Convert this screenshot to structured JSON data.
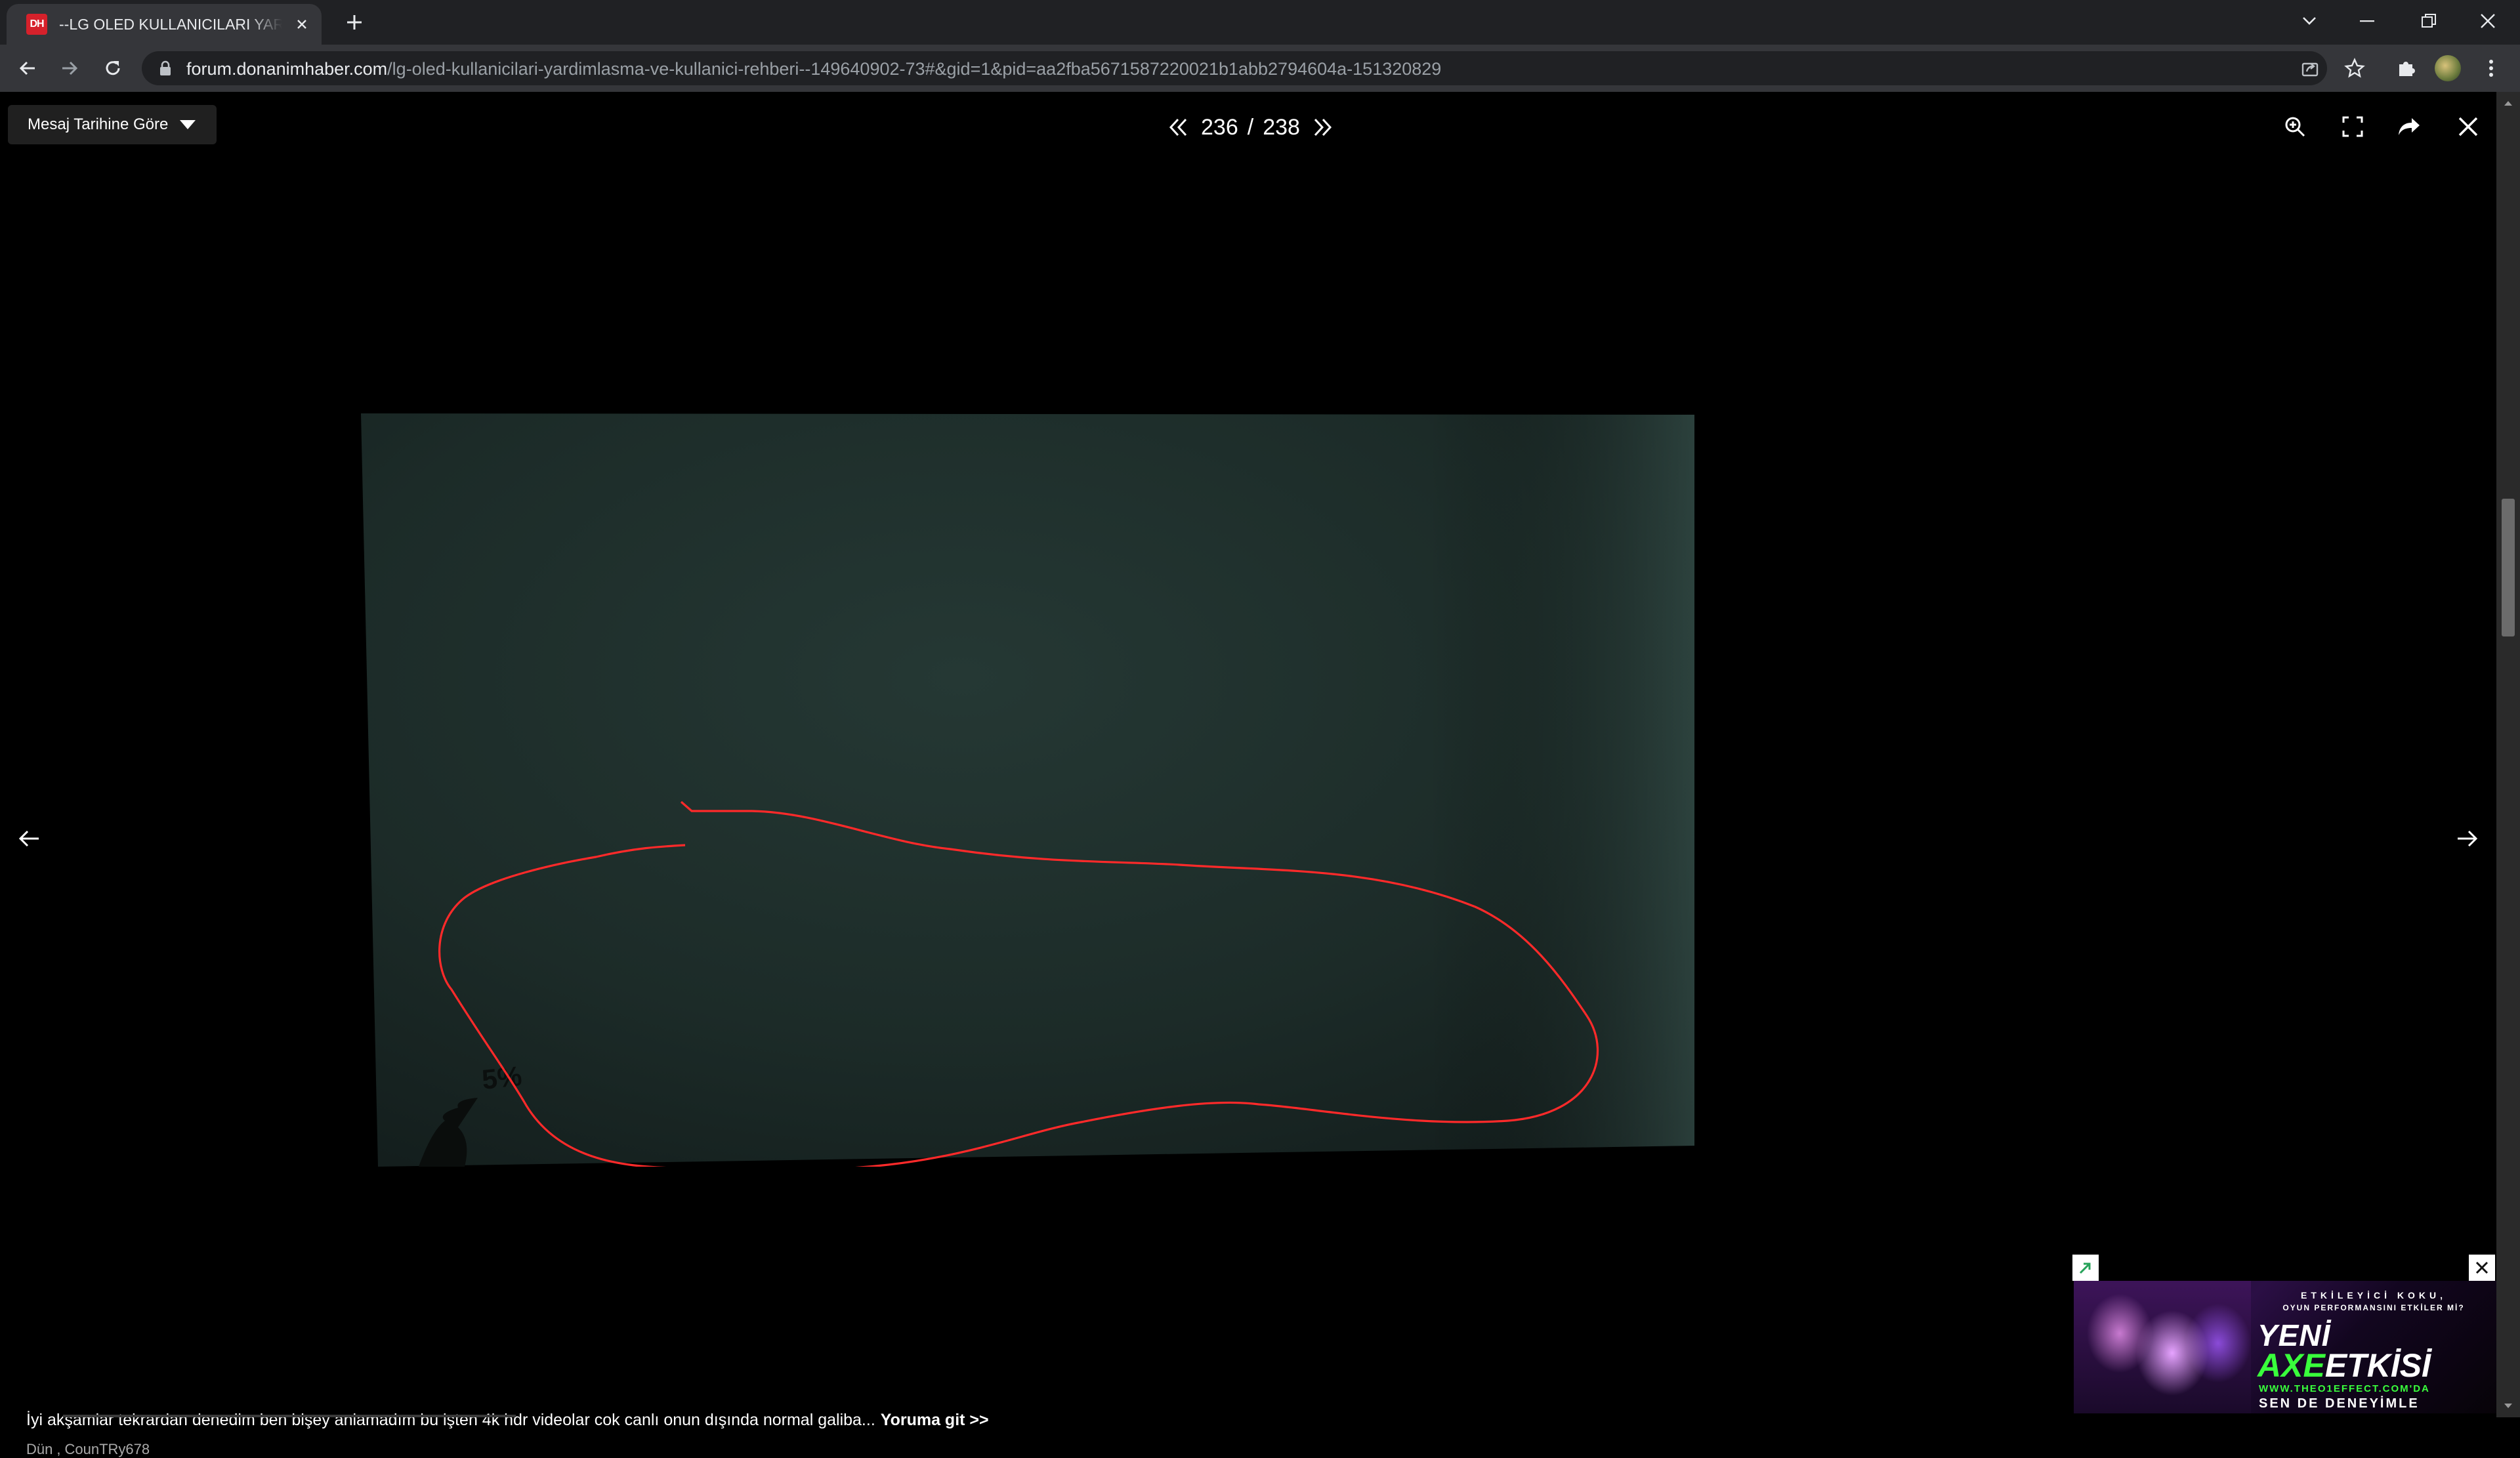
{
  "browser": {
    "tab": {
      "favicon_text": "DH",
      "title": "--LG OLED KULLANICILARI YARDIMLAŞMA VE KULLANICI REHBERİ--"
    },
    "address": {
      "host": "forum.donanimhaber.com",
      "path": "/lg-oled-kullanicilari-yardimlasma-ve-kullanici-rehberi--149640902-73#&gid=1&pid=aa2fba5671587220021b1abb2794604a-151320829"
    }
  },
  "viewer": {
    "sort_button_label": "Mesaj Tarihine Göre",
    "pager": {
      "current": "236",
      "separator": "/",
      "total": "238"
    },
    "photo": {
      "handwritten_label": "5%",
      "annotation_color": "#ff2a2a"
    }
  },
  "post": {
    "text": "İyi akşamlar tekrardan denedim ben bişey anlamadım bu işten 4k hdr videolar cok canlı onun dışında normal galiba...",
    "link_label": "Yoruma git >>",
    "date": "Dün",
    "separator": ",",
    "author": "CounTRy678"
  },
  "ad": {
    "tagline_1": "ETKİLEYİCİ KOKU,",
    "tagline_2": "OYUN PERFORMANSINI ETKİLER Mİ?",
    "headline_1": "YENİ",
    "headline_2a": "AXE",
    "headline_2b": "ETKİSİ",
    "site": "WWW.THEO1EFFECT.COM'DA",
    "cta": "SEN DE DENEYİMLE"
  }
}
